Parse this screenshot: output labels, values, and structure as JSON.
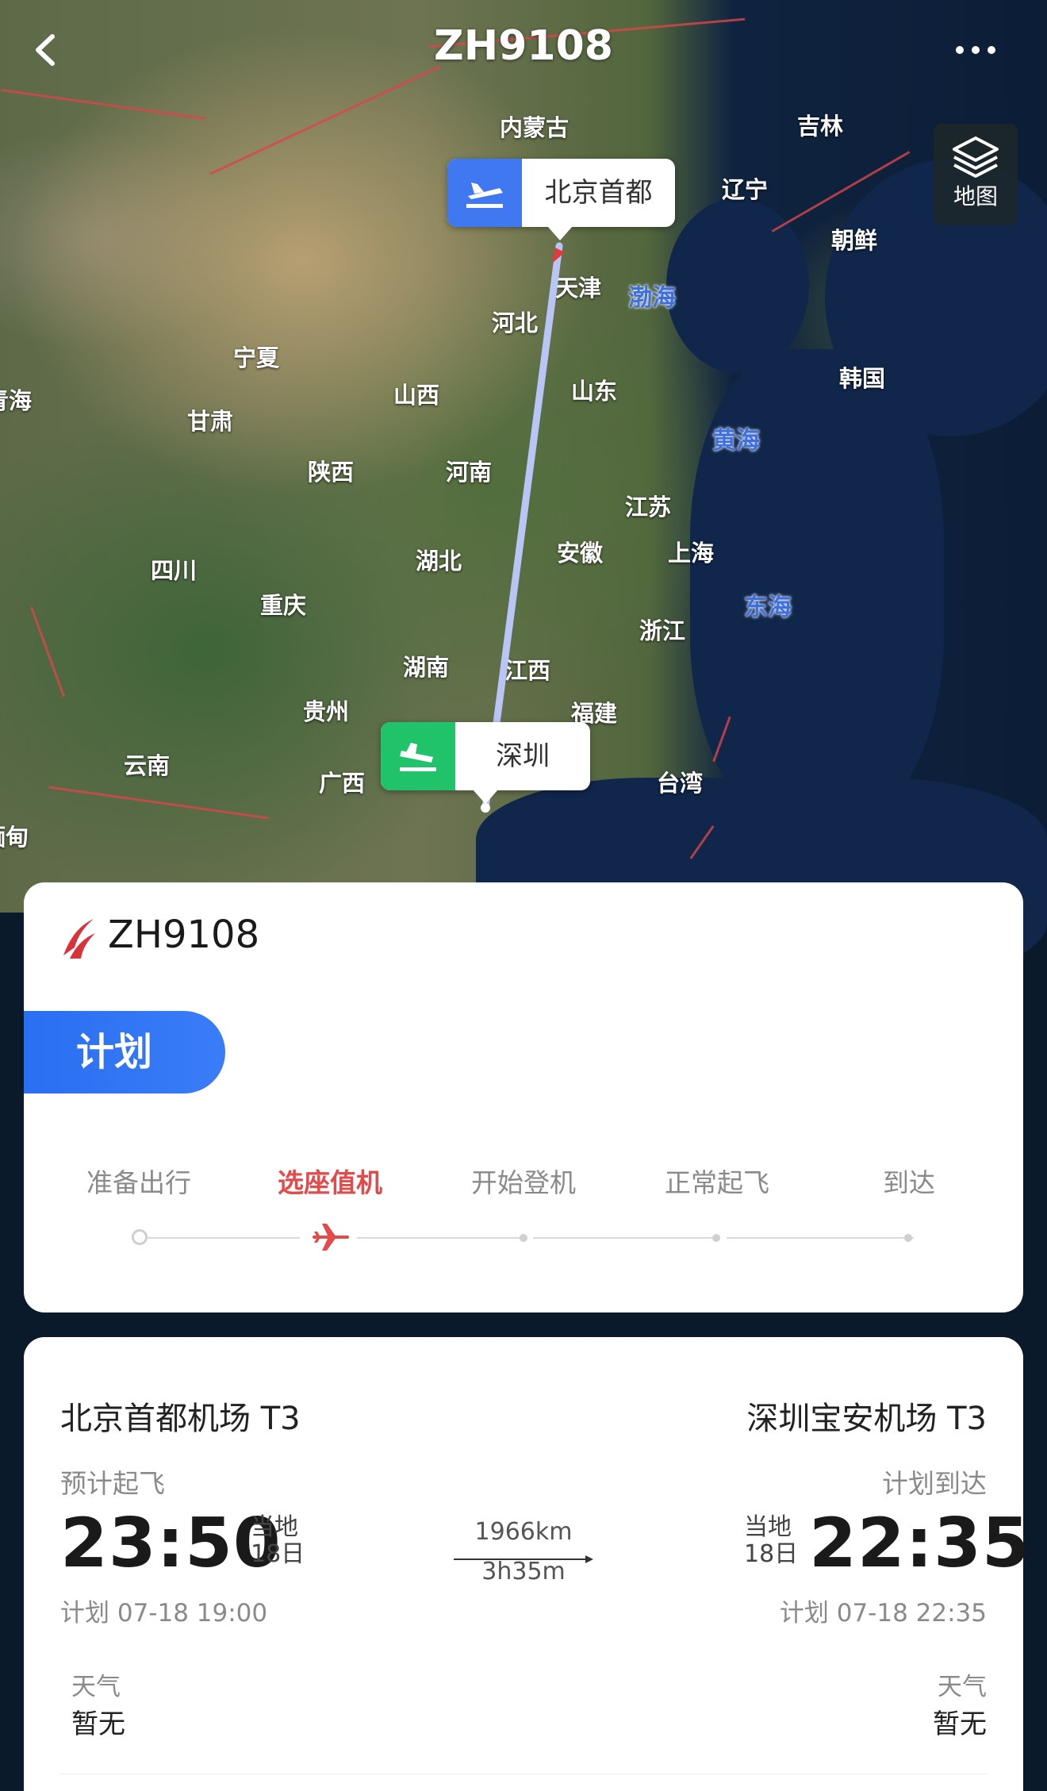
{
  "header": {
    "title": "ZH9108",
    "layers_label": "地图"
  },
  "map": {
    "regions": [
      {
        "id": "neimenggu",
        "label": "内蒙古"
      },
      {
        "id": "jilin",
        "label": "吉林"
      },
      {
        "id": "liaoning",
        "label": "辽宁"
      },
      {
        "id": "chaoxian",
        "label": "朝鲜"
      },
      {
        "id": "tianjin",
        "label": "天津"
      },
      {
        "id": "hebei",
        "label": "河北"
      },
      {
        "id": "ningxia",
        "label": "宁夏"
      },
      {
        "id": "qinghai",
        "label": "青海"
      },
      {
        "id": "gansu",
        "label": "甘肃"
      },
      {
        "id": "shanxi",
        "label": "山西"
      },
      {
        "id": "shandong",
        "label": "山东"
      },
      {
        "id": "hanguo",
        "label": "韩国"
      },
      {
        "id": "shaanxi",
        "label": "陕西"
      },
      {
        "id": "henan",
        "label": "河南"
      },
      {
        "id": "jiangsu",
        "label": "江苏"
      },
      {
        "id": "sichuan",
        "label": "四川"
      },
      {
        "id": "hubei",
        "label": "湖北"
      },
      {
        "id": "anhui",
        "label": "安徽"
      },
      {
        "id": "shanghai",
        "label": "上海"
      },
      {
        "id": "chongqing",
        "label": "重庆"
      },
      {
        "id": "zhejiang",
        "label": "浙江"
      },
      {
        "id": "hunan",
        "label": "湖南"
      },
      {
        "id": "jiangxi",
        "label": "江西"
      },
      {
        "id": "guizhou",
        "label": "贵州"
      },
      {
        "id": "fujian",
        "label": "福建"
      },
      {
        "id": "yunnan",
        "label": "云南"
      },
      {
        "id": "guangxi",
        "label": "广西"
      },
      {
        "id": "taiwan",
        "label": "台湾"
      },
      {
        "id": "miandian",
        "label": "缅甸"
      }
    ],
    "seas": [
      {
        "id": "bohai",
        "label": "渤海"
      },
      {
        "id": "huanghai",
        "label": "黄海"
      },
      {
        "id": "donghai",
        "label": "东海"
      }
    ],
    "origin_pin": "北京首都",
    "dest_pin": "深圳",
    "route_color": "#b9c6f5"
  },
  "status_card": {
    "flight_no": "ZH9108",
    "status": "计划",
    "steps": [
      "准备出行",
      "选座值机",
      "开始登机",
      "正常起飞",
      "到达"
    ],
    "active_step": 1,
    "accent": "#e34b4b",
    "brand": "#2a6ff2"
  },
  "times_card": {
    "dep_airport": "北京首都机场 T3",
    "arr_airport": "深圳宝安机场 T3",
    "dep_sub": "预计起飞",
    "arr_sub": "计划到达",
    "dep_time": "23:50",
    "arr_time": "22:35",
    "dep_local_a": "当地",
    "dep_local_b": "18日",
    "arr_local_a": "当地",
    "arr_local_b": "18日",
    "distance": "1966km",
    "duration": "3h35m",
    "dep_plan": "计划 07-18 19:00",
    "arr_plan": "计划 07-18 22:35",
    "weather_label": "天气",
    "dep_weather": "暂无",
    "arr_weather": "暂无"
  }
}
